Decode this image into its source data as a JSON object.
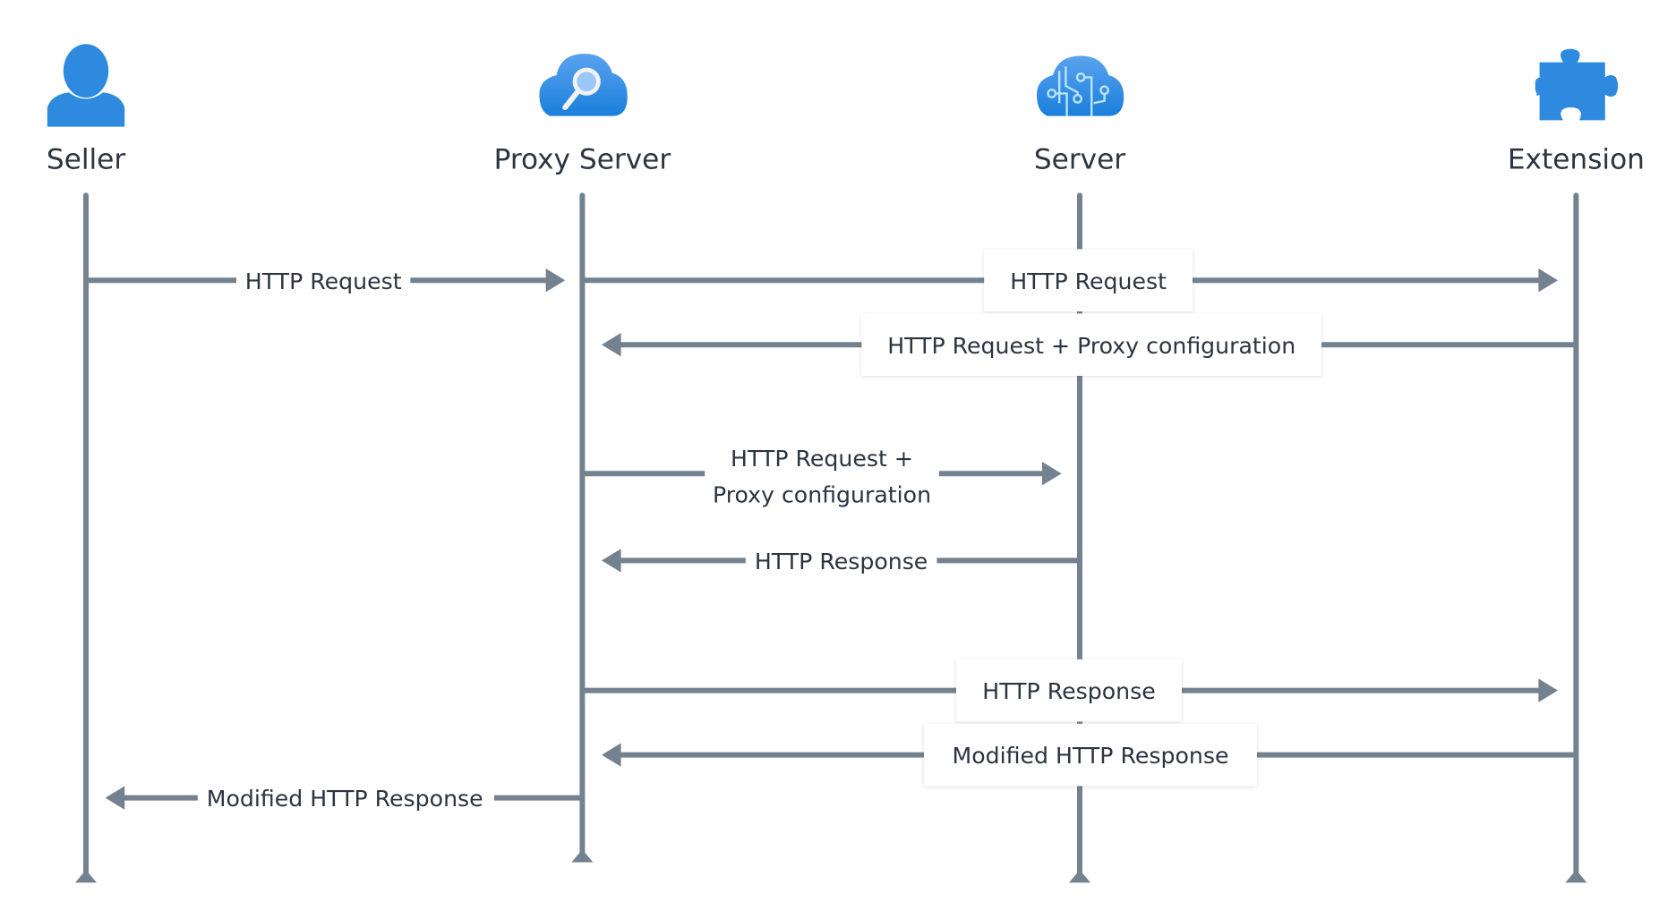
{
  "actors": [
    {
      "name": "Seller",
      "icon": "user-icon"
    },
    {
      "name": "Proxy Server",
      "icon": "cloud-search-icon"
    },
    {
      "name": "Server",
      "icon": "cloud-circuit-icon"
    },
    {
      "name": "Extension",
      "icon": "puzzle-piece-icon"
    }
  ],
  "messages": [
    {
      "from": "Seller",
      "to": "Proxy Server",
      "label": "HTTP Request"
    },
    {
      "from": "Proxy Server",
      "to": "Extension",
      "label": "HTTP Request"
    },
    {
      "from": "Extension",
      "to": "Proxy Server",
      "label": "HTTP Request + Proxy configuration"
    },
    {
      "from": "Proxy Server",
      "to": "Server",
      "label_line1": "HTTP Request +",
      "label_line2": "Proxy configuration"
    },
    {
      "from": "Server",
      "to": "Proxy Server",
      "label": "HTTP Response"
    },
    {
      "from": "Proxy Server",
      "to": "Extension",
      "label": "HTTP Response"
    },
    {
      "from": "Extension",
      "to": "Proxy Server",
      "label": "Modified HTTP Response"
    },
    {
      "from": "Proxy Server",
      "to": "Seller",
      "label": "Modified HTTP Response"
    }
  ],
  "colors": {
    "icon": "#2e8ade",
    "line": "#74828f",
    "text": "#2b3440"
  }
}
